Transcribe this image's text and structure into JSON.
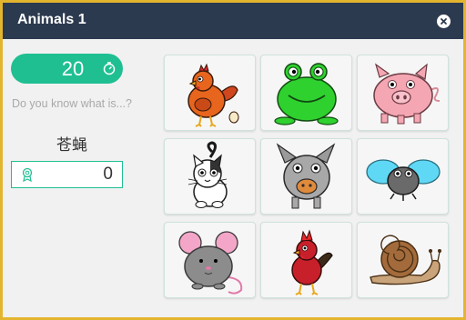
{
  "window": {
    "title": "Animals 1"
  },
  "timer": {
    "value": "20",
    "icon": "stopwatch-icon"
  },
  "prompt": {
    "question": "Do you know what is...?",
    "answer": "苍蝇"
  },
  "score": {
    "value": "0",
    "icon": "award-icon"
  },
  "cards": [
    {
      "animal": "hen"
    },
    {
      "animal": "frog"
    },
    {
      "animal": "pig"
    },
    {
      "animal": "cat"
    },
    {
      "animal": "donkey"
    },
    {
      "animal": "fly"
    },
    {
      "animal": "mouse"
    },
    {
      "animal": "rooster"
    },
    {
      "animal": "snail"
    }
  ],
  "colors": {
    "titlebar": "#2c3a4f",
    "accent": "#1fbf92",
    "frame": "#e3b52e"
  }
}
